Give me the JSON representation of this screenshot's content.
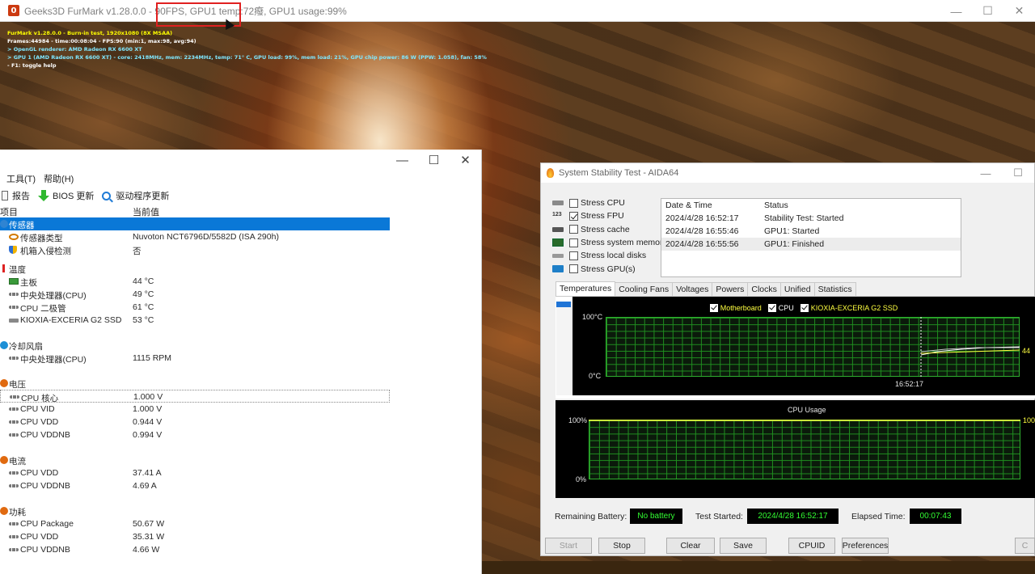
{
  "furmark": {
    "title": "Geeks3D FurMark v1.28.0.0 - 90FPS, GPU1 temp:72癈, GPU1 usage:99%",
    "icon_letter": "0",
    "osd": [
      "FurMark v1.28.0.0 - Burn-in test, 1920x1080 (8X MSAA)",
      "Frames:44984 - time:00:08:04 - FPS:90 (min:1, max:98, avg:94)",
      "> OpenGL renderer: AMD Radeon RX 6600 XT",
      "> GPU 1 (AMD Radeon RX 6600 XT) - core: 2418MHz, mem: 2234MHz, temp: 71° C, GPU load: 99%, mem load: 21%, GPU chip power: 86 W (PPW: 1.058), fan: 58%",
      "- F1: toggle help"
    ]
  },
  "hwinfo": {
    "menu": [
      "工具(T)",
      "帮助(H)"
    ],
    "toolbar": {
      "report": "报告",
      "bios": "BIOS 更新",
      "driver": "驱动程序更新"
    },
    "columns": {
      "item": "项目",
      "value": "当前值"
    },
    "rows": [
      {
        "name": "传感器",
        "value": ""
      },
      {
        "name": "传感器类型",
        "value": "Nuvoton NCT6796D/5582D  (ISA 290h)"
      },
      {
        "name": "机箱入侵检测",
        "value": "否"
      },
      {
        "name": "温度",
        "value": ""
      },
      {
        "name": "主板",
        "value": "44 °C"
      },
      {
        "name": "中央处理器(CPU)",
        "value": "49 °C"
      },
      {
        "name": "CPU 二极管",
        "value": "61 °C"
      },
      {
        "name": "KIOXIA-EXCERIA G2 SSD",
        "value": "53 °C"
      },
      {
        "name": "冷却风扇",
        "value": ""
      },
      {
        "name": "中央处理器(CPU)",
        "value": "1115 RPM"
      },
      {
        "name": "电压",
        "value": ""
      },
      {
        "name": "CPU 核心",
        "value": "1.000 V"
      },
      {
        "name": "CPU VID",
        "value": "1.000 V"
      },
      {
        "name": "CPU VDD",
        "value": "0.944 V"
      },
      {
        "name": "CPU VDDNB",
        "value": "0.994 V"
      },
      {
        "name": "电流",
        "value": ""
      },
      {
        "name": "CPU VDD",
        "value": "37.41 A"
      },
      {
        "name": "CPU VDDNB",
        "value": "4.69 A"
      },
      {
        "name": "功耗",
        "value": ""
      },
      {
        "name": "CPU Package",
        "value": "50.67 W"
      },
      {
        "name": "CPU VDD",
        "value": "35.31 W"
      },
      {
        "name": "CPU VDDNB",
        "value": "4.66 W"
      }
    ]
  },
  "aida": {
    "title": "System Stability Test - AIDA64",
    "stress": [
      {
        "label": "Stress CPU",
        "checked": false
      },
      {
        "label": "Stress FPU",
        "checked": true
      },
      {
        "label": "Stress cache",
        "checked": false
      },
      {
        "label": "Stress system memory",
        "checked": false
      },
      {
        "label": "Stress local disks",
        "checked": false
      },
      {
        "label": "Stress GPU(s)",
        "checked": false
      }
    ],
    "log_headers": {
      "date": "Date & Time",
      "status": "Status"
    },
    "log": [
      {
        "date": "2024/4/28 16:52:17",
        "status": "Stability Test: Started"
      },
      {
        "date": "2024/4/28 16:55:46",
        "status": "GPU1: Started"
      },
      {
        "date": "2024/4/28 16:55:56",
        "status": "GPU1: Finished"
      }
    ],
    "tabs": [
      "Temperatures",
      "Cooling Fans",
      "Voltages",
      "Powers",
      "Clocks",
      "Unified",
      "Statistics"
    ],
    "temp_graph": {
      "legend": [
        "Motherboard",
        "CPU",
        "KIOXIA-EXCERIA G2 SSD"
      ],
      "ymax": "100°C",
      "ymin": "0°C",
      "time": "16:52:17",
      "value": "44",
      "colors": {
        "motherboard": "#ffff40",
        "cpu": "#ffffff",
        "ssd": "#c8c8c8"
      }
    },
    "cpu_graph": {
      "title": "CPU Usage",
      "ymax": "100%",
      "ymin": "0%",
      "value": "100%",
      "color": "#ffff40"
    },
    "info": {
      "battery_label": "Remaining Battery:",
      "battery_value": "No battery",
      "started_label": "Test Started:",
      "started_value": "2024/4/28 16:52:17",
      "elapsed_label": "Elapsed Time:",
      "elapsed_value": "00:07:43"
    },
    "buttons": {
      "start": "Start",
      "stop": "Stop",
      "clear": "Clear",
      "save": "Save",
      "cpuid": "CPUID",
      "prefs": "Preferences",
      "close": "C"
    }
  }
}
